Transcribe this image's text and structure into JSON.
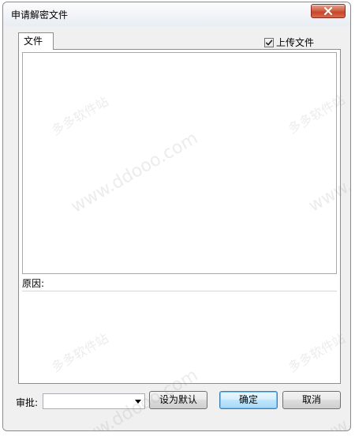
{
  "window": {
    "title": "申请解密文件"
  },
  "icons": {
    "close": "close-icon",
    "checkbox": "checkmark-icon",
    "dropdown": "chevron-down-icon"
  },
  "tab": {
    "label": "文件"
  },
  "upload": {
    "label": "上传文件",
    "checked": true
  },
  "reason": {
    "label": "原因:",
    "value": ""
  },
  "approver": {
    "label": "审批:",
    "value": ""
  },
  "buttons": {
    "set_default": "设为默认",
    "ok": "确定",
    "cancel": "取消"
  },
  "watermarks": {
    "cn": "多多软件站",
    "url": "www.ddooo.com"
  }
}
